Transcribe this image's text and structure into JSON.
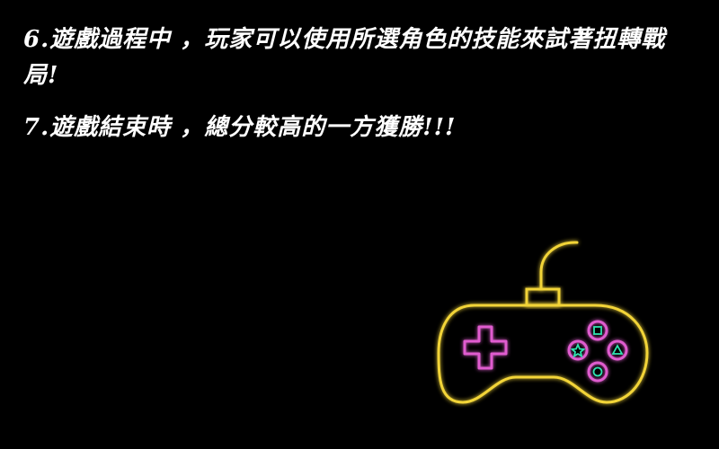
{
  "rules": [
    {
      "text": "6.遊戲過程中 ，玩家可以使用所選角色的技能來試著扭轉戰局!"
    },
    {
      "text": "7.遊戲結束時 ，總分較高的一方獲勝!!!"
    }
  ],
  "illustration": {
    "icon": "neon-gamepad-icon",
    "colors": {
      "body": "#f2d437",
      "dpad": "#e05ccf",
      "buttons": "#e05ccf",
      "symbols": "#2fe3b0"
    }
  }
}
